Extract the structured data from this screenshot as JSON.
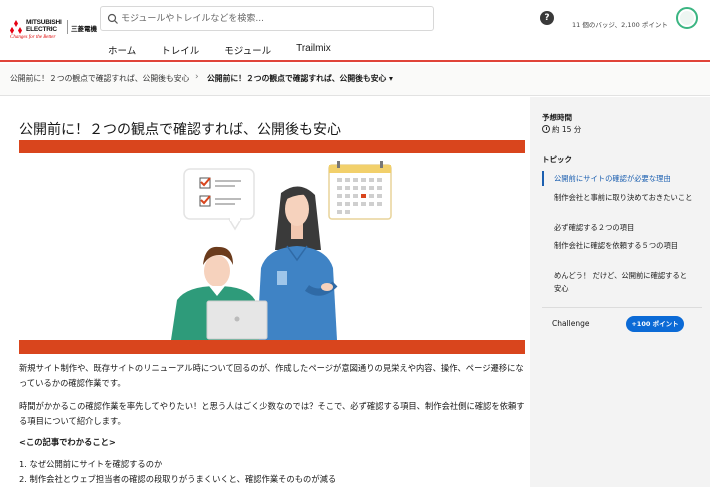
{
  "header": {
    "logo": {
      "name_line1": "MITSUBISHI",
      "name_line2": "ELECTRIC",
      "tagline": "Changes for the Better",
      "jp_name": "三菱電機"
    },
    "search_placeholder": "モジュールやトレイルなどを検索...",
    "nav": [
      "ホーム",
      "トレイル",
      "モジュール",
      "Trailmix"
    ],
    "badge_info": "11 個のバッジ、2,100 ポイント",
    "help_label": "?"
  },
  "breadcrumb": {
    "parent": "公開前に！２つの観点で確認すれば、公開後も安心",
    "separator": "›",
    "current": "公開前に！２つの観点で確認すれば、公開後も安心 ▾"
  },
  "main": {
    "title": "公開前に！２つの観点で確認すれば、公開後も安心",
    "paragraphs": [
      "新規サイト制作や、既存サイトのリニューアル時について回るのが、作成したページが意図通りの見栄えや内容、操作、ページ遷移になっているかの確認作業です。",
      "時間がかかるこの確認作業を率先してやりたい！と思う人はごく少数なのでは？そこで、必ず確認する項目、制作会社側に確認を依頼する項目について紹介します。",
      "<この記事でわかること>",
      "1. なぜ公開前にサイトを確認するのか",
      "2. 制作会社とウェブ担当者の確認の段取りがうまくいくと、確認作業そのものが減る"
    ]
  },
  "sidebar": {
    "estimate_label": "予想時間",
    "estimate_value": "約 15 分",
    "topics_label": "トピック",
    "topics": [
      "公開前にサイトの確認が必要な理由",
      "制作会社と事前に取り決めておきたいこと",
      "必ず確認する２つの項目",
      "制作会社に確認を依頼する５つの項目",
      "めんどう！ だけど、公開前に確認すると安心"
    ],
    "challenge_label": "Challenge",
    "points_label": "+100 ポイント"
  },
  "colors": {
    "accent_red": "#d9451d",
    "link_blue": "#1b5fb0",
    "button_blue": "#0b6ad6",
    "header_rule": "#e0443a"
  }
}
